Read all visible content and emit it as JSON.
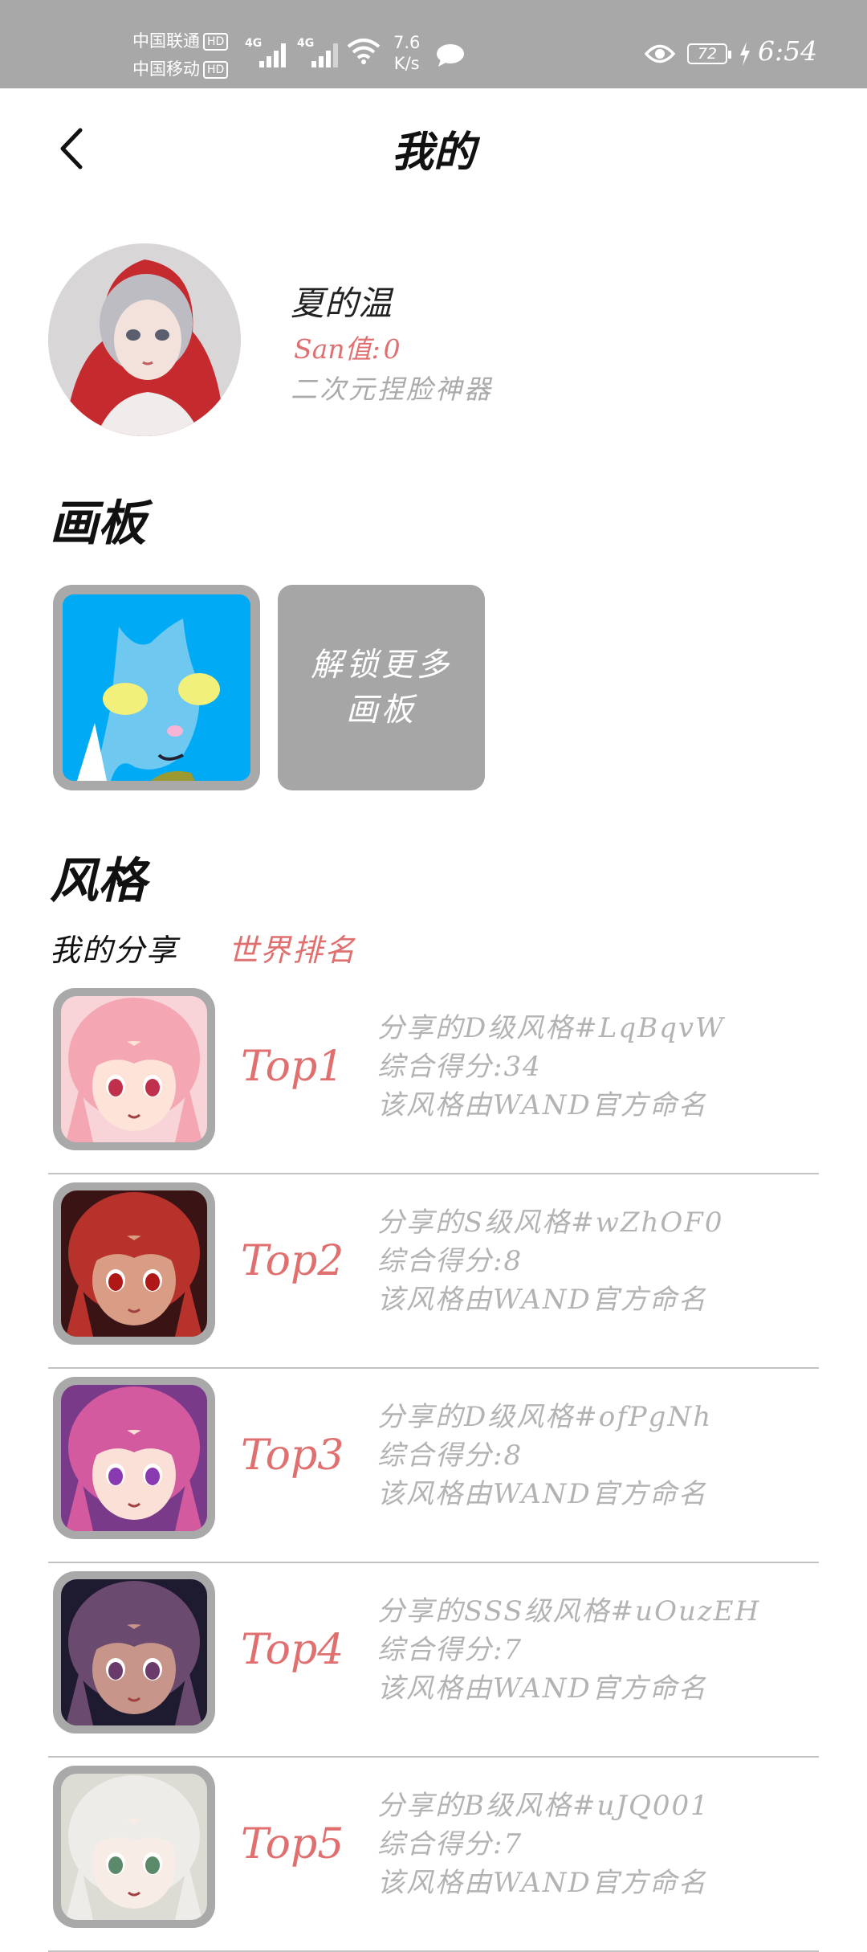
{
  "status_bar": {
    "carrier1": "中国联通",
    "carrier2": "中国移动",
    "hd": "HD",
    "net1": "4G",
    "net2": "4G",
    "speed_value": "7.6",
    "speed_unit": "K/s",
    "battery": "72",
    "time": "6:54"
  },
  "header": {
    "title": "我的"
  },
  "profile": {
    "name": "夏的温",
    "san_label": "San值:",
    "san_value": "0",
    "bio": "二次元捏脸神器"
  },
  "boards": {
    "title": "画板",
    "unlock_line1": "解锁更多",
    "unlock_line2": "画板"
  },
  "styles": {
    "title": "风格",
    "tab_mine": "我的分享",
    "tab_world": "世界排名",
    "items": [
      {
        "rank": "Top1",
        "line1": "分享的D级风格#LqBqvW",
        "line2": "综合得分:34",
        "line3": "该风格由WAND官方命名",
        "hair": "#f4a6b2",
        "skin": "#fde3d8",
        "eye": "#c0304c",
        "bg": "#f8d4d8"
      },
      {
        "rank": "Top2",
        "line1": "分享的S级风格#wZhOF0",
        "line2": "综合得分:8",
        "line3": "该风格由WAND官方命名",
        "hair": "#b8322c",
        "skin": "#d99c84",
        "eye": "#b01818",
        "bg": "#3a1414"
      },
      {
        "rank": "Top3",
        "line1": "分享的D级风格#ofPgNh",
        "line2": "综合得分:8",
        "line3": "该风格由WAND官方命名",
        "hair": "#d45aa0",
        "skin": "#fbe0d8",
        "eye": "#8a3ab0",
        "bg": "#7a3a8a"
      },
      {
        "rank": "Top4",
        "line1": "分享的SSS级风格#uOuzEH",
        "line2": "综合得分:7",
        "line3": "该风格由WAND官方命名",
        "hair": "#6a4a6e",
        "skin": "#c8958a",
        "eye": "#6a3a6a",
        "bg": "#1e1a30"
      },
      {
        "rank": "Top5",
        "line1": "分享的B级风格#uJQ001",
        "line2": "综合得分:7",
        "line3": "该风格由WAND官方命名",
        "hair": "#eeece8",
        "skin": "#f8ece6",
        "eye": "#5a8a6a",
        "bg": "#dcdcd4"
      }
    ]
  }
}
